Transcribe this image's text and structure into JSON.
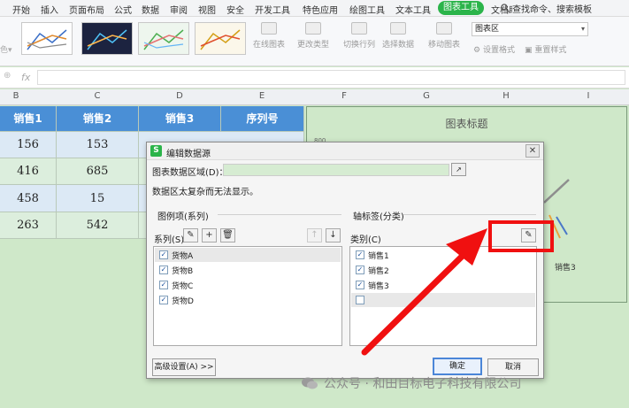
{
  "menu": [
    "开始",
    "插入",
    "页面布局",
    "公式",
    "数据",
    "审阅",
    "视图",
    "安全",
    "开发工具",
    "特色应用",
    "绘图工具",
    "文本工具",
    "图表工具",
    "文档助"
  ],
  "search_label": "查找命令、搜索模板",
  "ribbon": {
    "buttons": [
      "在线图表",
      "更改类型",
      "切换行列",
      "选择数据",
      "移动图表"
    ],
    "chart_area_select": "图表区",
    "set_format": "设置格式",
    "reset_style": "重置样式"
  },
  "formula": {
    "fx": "fx"
  },
  "columns": [
    "B",
    "C",
    "D",
    "E",
    "F",
    "G",
    "H",
    "I"
  ],
  "sheet": {
    "headers": [
      "销售1",
      "销售2",
      "销售3",
      "序列号"
    ],
    "rows": [
      [
        "156",
        "153"
      ],
      [
        "416",
        "685"
      ],
      [
        "458",
        "15"
      ],
      [
        "263",
        "542"
      ]
    ]
  },
  "chart": {
    "title": "图表标题",
    "axis_tick": "800",
    "legend_item": "销售3"
  },
  "dialog": {
    "title": "编辑数据源",
    "range_label": "图表数据区域(D)：",
    "too_complex": "数据区太复杂而无法显示。",
    "legend_group": "图例项(系列)",
    "series_label": "系列(S)",
    "axis_group": "轴标签(分类)",
    "category_label": "类别(C)",
    "series_items": [
      "货物A",
      "货物B",
      "货物C",
      "货物D"
    ],
    "category_items": [
      "销售1",
      "销售2",
      "销售3"
    ],
    "advanced_button": "高级设置(A) >>",
    "ok_button": "确定",
    "cancel_button": "取消"
  },
  "watermark": "公众号 · 和田目标电子科技有限公司",
  "colors": {
    "accent": "#2bb44a",
    "header_blue": "#4a8fd6",
    "highlight_red": "#f01010"
  }
}
